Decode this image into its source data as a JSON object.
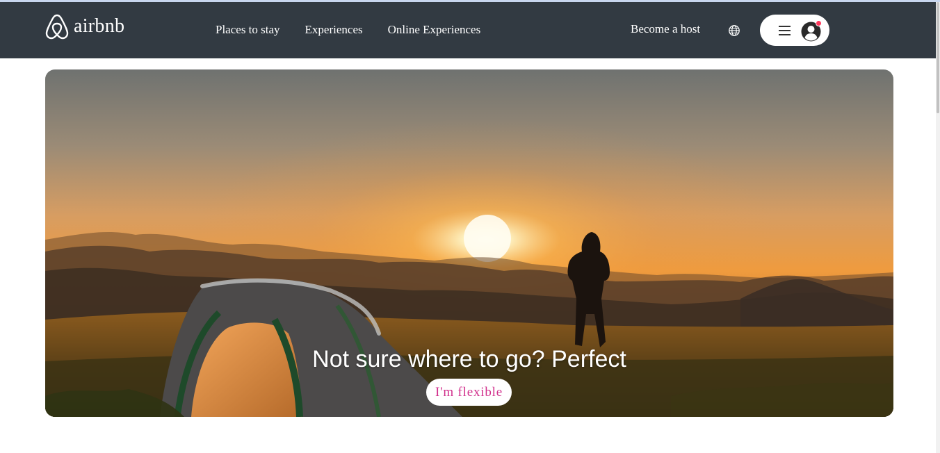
{
  "brand": {
    "name": "airbnb",
    "logo_icon": "airbnb-belo-icon"
  },
  "nav": {
    "links": [
      "Places to stay",
      "Experiences",
      "Online Experiences"
    ],
    "host_label": "Become a host",
    "globe_icon": "globe-icon",
    "menu_icon": "hamburger-icon",
    "avatar_icon": "user-avatar-icon"
  },
  "hero": {
    "title": "Not sure where to go? Perfect",
    "button_label": "I'm flexible"
  },
  "colors": {
    "navbar_bg": "#323a42",
    "accent": "#ff385c",
    "button_text": "#d12f8c"
  }
}
